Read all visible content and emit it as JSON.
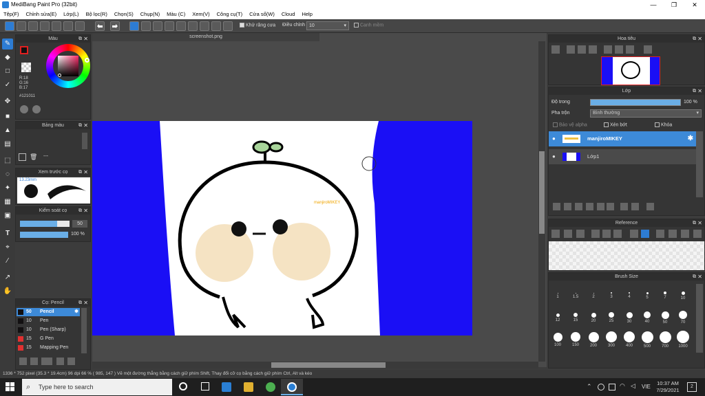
{
  "window": {
    "title": "MediBang Paint Pro (32bit)"
  },
  "menu": [
    "Tệp(F)",
    "Chỉnh sửa(E)",
    "Lớp(L)",
    "Bộ lọc(R)",
    "Chọn(S)",
    "Chụp(N)",
    "Màu (C)",
    "Xem(V)",
    "Công cụ(T)",
    "Cửa sổ(W)",
    "Cloud",
    "Help"
  ],
  "toolbar": {
    "antialias": "Khử răng cưa",
    "adjust_label": "Điều chỉnh",
    "adjust_value": "10",
    "snap": "Canh mềm"
  },
  "color_panel": {
    "title": "Màu",
    "r": "R:18",
    "g": "G:16",
    "b": "B:17",
    "hex": "#121011"
  },
  "palette_panel": {
    "title": "Bảng màu",
    "dash": "---"
  },
  "preview_panel": {
    "title": "Xem trước cọ",
    "size": "13.23mm"
  },
  "brush_control": {
    "title": "Kiểm soát cọ",
    "size": "50",
    "opacity": "100 %"
  },
  "brush_list": {
    "title": "Cọ: Pencil",
    "items": [
      {
        "n": "50",
        "name": "Pencil",
        "color": "#121011"
      },
      {
        "n": "10",
        "name": "Pen",
        "color": "#121011"
      },
      {
        "n": "10",
        "name": "Pen (Sharp)",
        "color": "#121011"
      },
      {
        "n": "15",
        "name": "G Pen",
        "color": "#e03030"
      },
      {
        "n": "15",
        "name": "Mapping Pen",
        "color": "#e03030"
      }
    ]
  },
  "document": {
    "tab": "screenshot.png",
    "annotation": "manjiroMIKEY"
  },
  "navigator": {
    "title": "Hoa tiêu"
  },
  "layers": {
    "title": "Lớp",
    "opacity_label": "Độ trong",
    "opacity_value": "100 %",
    "blend_label": "Pha trộn",
    "blend_value": "Bình thường",
    "protect_alpha": "Bảo vệ alpha",
    "clipping": "Xén bớt",
    "lock": "Khóa",
    "items": [
      {
        "name": "manjiroMIKEY"
      },
      {
        "name": "Lớp1"
      }
    ]
  },
  "reference": {
    "title": "Reference"
  },
  "brush_size": {
    "title": "Brush Size",
    "sizes": [
      "1",
      "1.5",
      "2",
      "3",
      "4",
      "5",
      "7",
      "10",
      "12",
      "15",
      "20",
      "25",
      "30",
      "40",
      "50",
      "70",
      "100",
      "150",
      "200",
      "300",
      "400",
      "500",
      "700",
      "1000"
    ]
  },
  "status": {
    "text": "1336 * 752 pixel  (35.3 * 19.4cm)  96 dpi  66 %  ( 985, 147 )  Vẽ một đường thẳng bằng cách giữ phím Shift, Thay đổi cỡ cọ bằng cách giữ phím Ctrl, Alt và kéo"
  },
  "taskbar": {
    "search": "Type here to search",
    "lang": "VIE",
    "time": "10:37 AM",
    "date": "7/29/2021",
    "badge": "2"
  }
}
